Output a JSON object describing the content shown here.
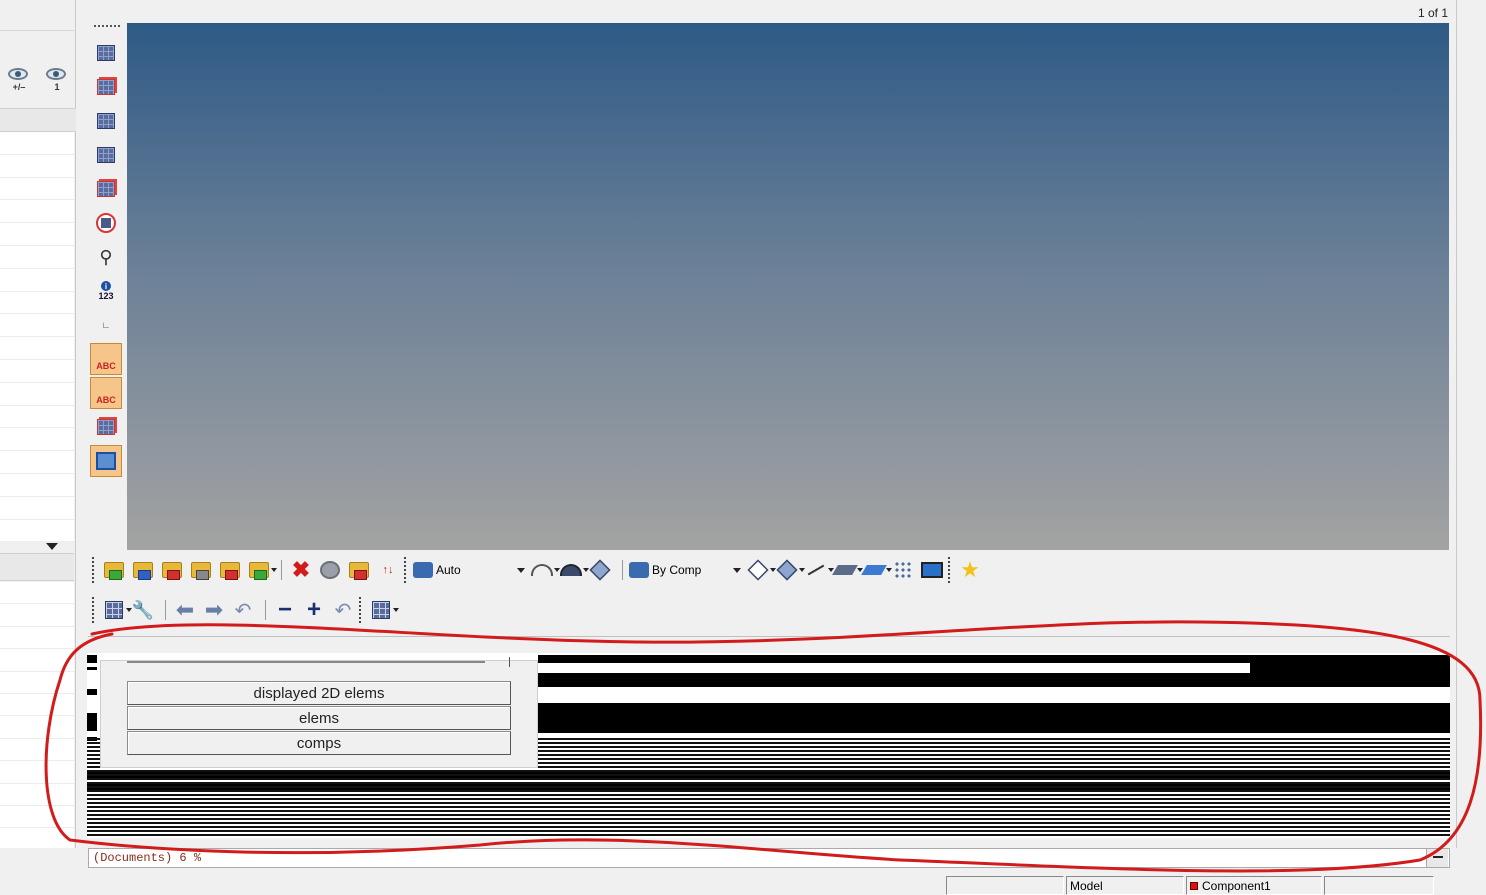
{
  "page_indicator": "1 of 1",
  "left_panel": {
    "eye_toggles": [
      {
        "icon": "eye-icon",
        "label": "+/–"
      },
      {
        "icon": "eye-icon",
        "label": "1"
      }
    ]
  },
  "vertical_toolbar": {
    "icons": [
      "mesh-icon",
      "mesh-red-icon",
      "mesh-icon",
      "mesh-icon",
      "mesh-red-icon",
      "isolate-icon",
      "binoculars-icon",
      "info-123-icon",
      "scale-icon",
      "abc-mesh-icon",
      "abc-load-icon",
      "transform-icon",
      "box-select-icon"
    ],
    "info_label": "123",
    "abc_label": "ABC"
  },
  "toolbar1": {
    "auto_combo": "Auto",
    "color_combo": "By Comp"
  },
  "dropdown_menu": {
    "items": [
      "displayed 2D elems",
      "elems",
      "comps"
    ]
  },
  "command_line": {
    "text": "(Documents) 6 %"
  },
  "status_bar": {
    "model": "Model",
    "component": "Component1"
  },
  "colors": {
    "viewport_top": "#2e5a86",
    "viewport_bottom": "#a3a3a3",
    "annotation": "#d21c1c",
    "active_tool": "#f5c58a"
  }
}
